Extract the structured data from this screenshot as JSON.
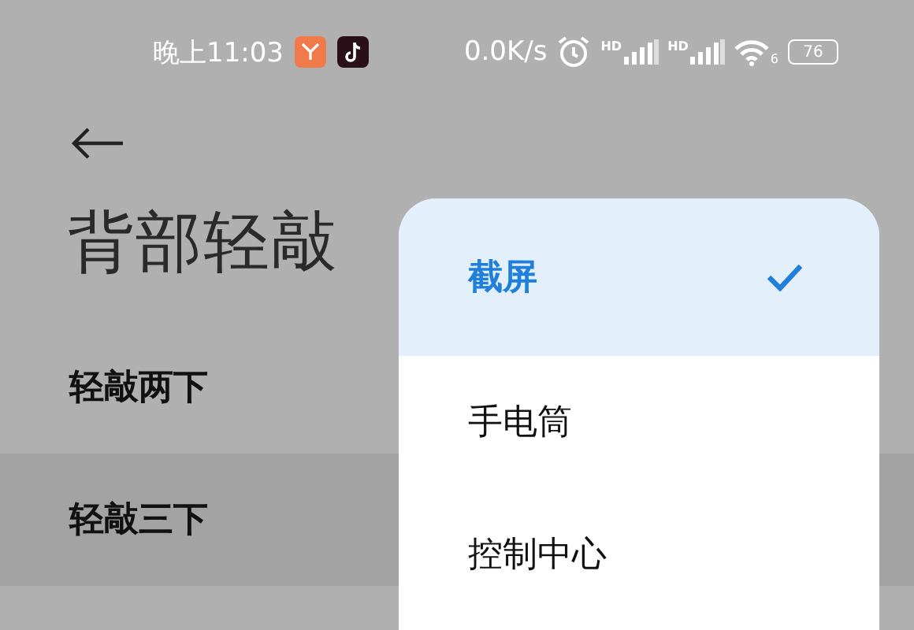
{
  "status_bar": {
    "time": "晚上11:03",
    "notification_apps": [
      {
        "kind": "shop"
      },
      {
        "kind": "music"
      }
    ],
    "net_speed": "0.0K/s",
    "signals": [
      {
        "label": "HD"
      },
      {
        "label": "HD"
      }
    ],
    "wifi_label": "6",
    "battery": "76"
  },
  "header": {
    "title": "背部轻敲"
  },
  "settings": [
    {
      "label": "轻敲两下",
      "selected": false
    },
    {
      "label": "轻敲三下",
      "selected": true
    }
  ],
  "menu": {
    "items": [
      {
        "label": "截屏",
        "selected": true
      },
      {
        "label": "手电筒",
        "selected": false
      },
      {
        "label": "控制中心",
        "selected": false
      }
    ]
  }
}
